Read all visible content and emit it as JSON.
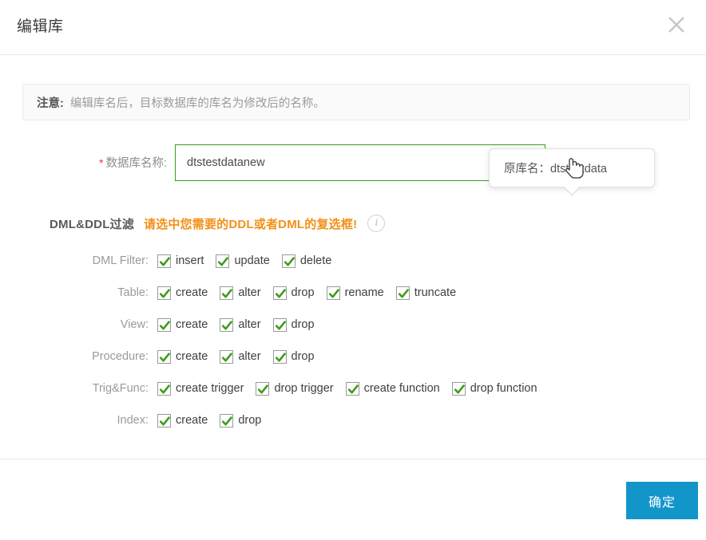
{
  "dialog": {
    "title": "编辑库",
    "close_icon": "close-icon"
  },
  "notice": {
    "label": "注意:",
    "text": "编辑库名后，目标数据库的库名为修改后的名称。"
  },
  "field": {
    "required_mark": "*",
    "label": "数据库名称:",
    "value": "dtstestdatanew",
    "placeholder": "",
    "info_icon": "info-icon",
    "border_color": "#3a9e1e"
  },
  "tooltip": {
    "text": "原库名：dtstestdata"
  },
  "section": {
    "title": "DML&DDL过滤",
    "warning": "请选中您需要的DDL或者DML的复选框!",
    "warning_color": "#f29018",
    "info_icon": "info-icon"
  },
  "filters": [
    {
      "label": "DML Filter:",
      "options": [
        {
          "label": "insert",
          "checked": true
        },
        {
          "label": "update",
          "checked": true
        },
        {
          "label": "delete",
          "checked": true
        }
      ]
    },
    {
      "label": "Table:",
      "options": [
        {
          "label": "create",
          "checked": true
        },
        {
          "label": "alter",
          "checked": true
        },
        {
          "label": "drop",
          "checked": true
        },
        {
          "label": "rename",
          "checked": true
        },
        {
          "label": "truncate",
          "checked": true
        }
      ]
    },
    {
      "label": "View:",
      "options": [
        {
          "label": "create",
          "checked": true
        },
        {
          "label": "alter",
          "checked": true
        },
        {
          "label": "drop",
          "checked": true
        }
      ]
    },
    {
      "label": "Procedure:",
      "options": [
        {
          "label": "create",
          "checked": true
        },
        {
          "label": "alter",
          "checked": true
        },
        {
          "label": "drop",
          "checked": true
        }
      ]
    },
    {
      "label": "Trig&Func:",
      "options": [
        {
          "label": "create trigger",
          "checked": true
        },
        {
          "label": "drop trigger",
          "checked": true
        },
        {
          "label": "create function",
          "checked": true
        },
        {
          "label": "drop function",
          "checked": true
        }
      ]
    },
    {
      "label": "Index:",
      "options": [
        {
          "label": "create",
          "checked": true
        },
        {
          "label": "drop",
          "checked": true
        }
      ]
    }
  ],
  "footer": {
    "confirm_label": "确定",
    "confirm_color": "#1296c9"
  },
  "cursor": {
    "type": "pointer-hand-cursor"
  }
}
